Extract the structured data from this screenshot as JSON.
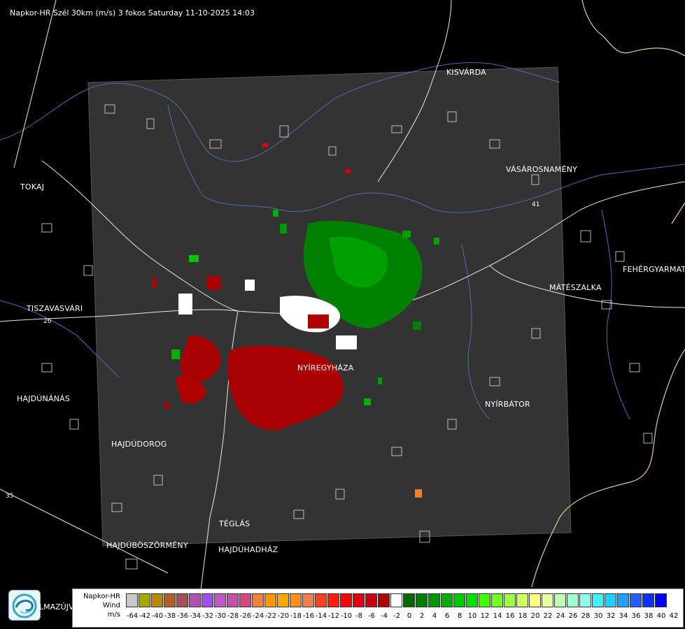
{
  "header": {
    "title": "Napkor-HR Szél 30km (m/s) 3 fokos Saturday 11-10-2025 14:03"
  },
  "towns": [
    {
      "name": "KISVÁRDA",
      "id": "kisvarda"
    },
    {
      "name": "TOKAJ",
      "id": "tokaj"
    },
    {
      "name": "VÁSÁROSNAMÉNY",
      "id": "vasarosnameny"
    },
    {
      "name": "FEHÉRGYARMAT",
      "id": "fehergyarmat"
    },
    {
      "name": "MÁTÉSZALKA",
      "id": "mateszalka"
    },
    {
      "name": "TISZAVASVÁRI",
      "id": "tiszavasvari"
    },
    {
      "name": "NYÍRBÁTOR",
      "id": "nyirbator"
    },
    {
      "name": "HAJDÚNÁNÁS",
      "id": "hajdunanas"
    },
    {
      "name": "HAJDÚDOROG",
      "id": "hajdudorog"
    },
    {
      "name": "TÉGLÁS",
      "id": "teglas"
    },
    {
      "name": "HAJDÚBÖSZÖRMÉNY",
      "id": "hajduboszormeny"
    },
    {
      "name": "HAJDÚHADHÁZ",
      "id": "hajduhadhaz"
    },
    {
      "name": "NYÍREGYHÁZA",
      "id": "nyiregyhaza"
    }
  ],
  "roads": [
    {
      "label": "26"
    },
    {
      "label": "41"
    },
    {
      "label": "35"
    }
  ],
  "logo": {
    "text": "LMAZÚJVÁR"
  },
  "legend": {
    "line1": "Napkor-HR",
    "line2": "Wind",
    "unit": "m/s",
    "colors": [
      "#c8c8c8",
      "#a8a800",
      "#b88a00",
      "#b06020",
      "#a85058",
      "#b050b0",
      "#a050e8",
      "#c058c8",
      "#c850a8",
      "#d84880",
      "#f08040",
      "#ff9800",
      "#ffa800",
      "#ff9020",
      "#f08050",
      "#ff4020",
      "#ff2010",
      "#ff0010",
      "#e00010",
      "#c80010",
      "#b00000",
      "#ffffff",
      "#006800",
      "#008000",
      "#009800",
      "#00b000",
      "#00c800",
      "#00e000",
      "#40ff00",
      "#70ff20",
      "#a0ff40",
      "#d0ff60",
      "#ffff80",
      "#e8ffa0",
      "#c0ffb0",
      "#a0ffd0",
      "#90fff0",
      "#40f0ff",
      "#20d0ff",
      "#20a0ff",
      "#2060ff",
      "#1030ff",
      "#0000ff"
    ],
    "ticks": [
      "-64",
      "-42",
      "-40",
      "-38",
      "-36",
      "-34",
      "-32",
      "-30",
      "-28",
      "-26",
      "-24",
      "-22",
      "-20",
      "-18",
      "-16",
      "-14",
      "-12",
      "-10",
      "-8",
      "-6",
      "-4",
      "-2",
      "0",
      "2",
      "4",
      "6",
      "8",
      "10",
      "12",
      "14",
      "16",
      "18",
      "20",
      "22",
      "24",
      "26",
      "28",
      "30",
      "32",
      "34",
      "36",
      "38",
      "40",
      "42"
    ]
  }
}
